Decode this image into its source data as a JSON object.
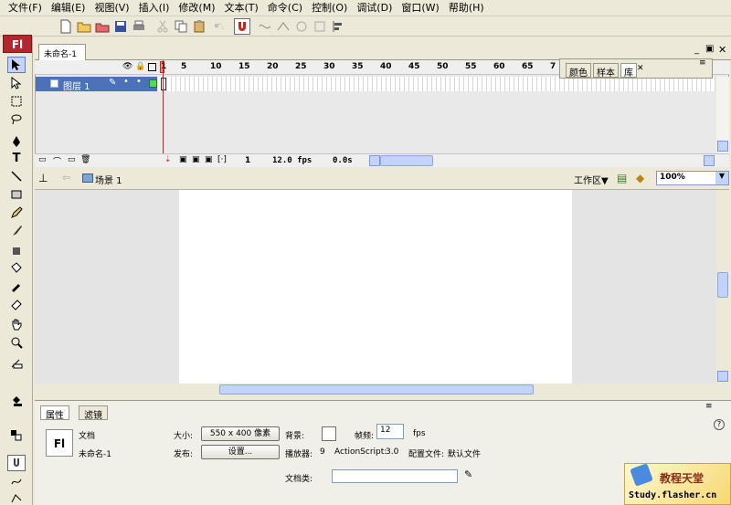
{
  "menu": [
    "文件(F)",
    "编辑(E)",
    "视图(V)",
    "插入(I)",
    "修改(M)",
    "文本(T)",
    "命令(C)",
    "控制(O)",
    "调试(D)",
    "窗口(W)",
    "帮助(H)"
  ],
  "app_badge": "Fl",
  "document": {
    "tab_title": "未命名-1"
  },
  "timeline": {
    "frame_numbers": [
      "1",
      "5",
      "10",
      "15",
      "20",
      "25",
      "30",
      "35",
      "40",
      "45",
      "50",
      "55",
      "60",
      "65",
      "7"
    ],
    "layer_name": "图层 1",
    "current_frame": "1",
    "frame_rate": "12.0 fps",
    "elapsed_time": "0.0s"
  },
  "panel_tabs": [
    "颜色",
    "样本",
    "库"
  ],
  "scene": {
    "label": "场景 1",
    "workspace_label": "工作区▼",
    "zoom": "100%"
  },
  "properties": {
    "tabs": [
      "属性",
      "滤镜"
    ],
    "doc_type": "文档",
    "doc_name": "未命名-1",
    "size_label": "大小:",
    "size_value": "550 x 400 像素",
    "background_label": "背景:",
    "frame_rate_label": "帧频:",
    "frame_rate_value": "12",
    "fps_unit": "fps",
    "publish_label": "发布:",
    "settings_button": "设置...",
    "player_label": "播放器:",
    "player_value": "9",
    "actionscript_label": "ActionScript:",
    "actionscript_value": "3.0",
    "profile_label": "配置文件:",
    "profile_value": "默认文件",
    "doc_class_label": "文档类:",
    "doc_class_value": ""
  },
  "watermark": {
    "title": "教程天堂",
    "url": "Study.flasher.cn"
  },
  "colors": {
    "layer_selected": "#4b72b8",
    "playhead": "#cc2222",
    "badge": "#b3262d"
  }
}
